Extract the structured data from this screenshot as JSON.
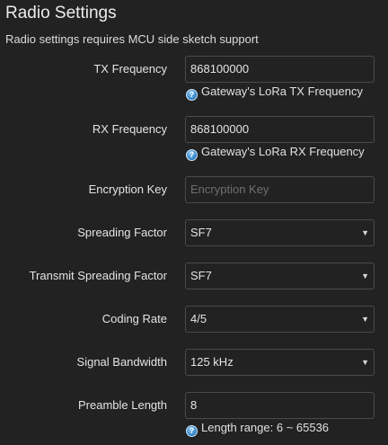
{
  "page": {
    "title": "Radio Settings",
    "description": "Radio settings requires MCU side sketch support"
  },
  "fields": {
    "tx_frequency": {
      "label": "TX Frequency",
      "value": "868100000",
      "hint": "Gateway's LoRa TX Frequency"
    },
    "rx_frequency": {
      "label": "RX Frequency",
      "value": "868100000",
      "hint": "Gateway's LoRa RX Frequency"
    },
    "encryption_key": {
      "label": "Encryption Key",
      "placeholder": "Encryption Key"
    },
    "spreading_factor": {
      "label": "Spreading Factor",
      "value": "SF7"
    },
    "transmit_spreading_factor": {
      "label": "Transmit Spreading Factor",
      "value": "SF7"
    },
    "coding_rate": {
      "label": "Coding Rate",
      "value": "4/5"
    },
    "signal_bandwidth": {
      "label": "Signal Bandwidth",
      "value": "125 kHz"
    },
    "preamble_length": {
      "label": "Preamble Length",
      "value": "8",
      "hint": "Length range: 6 ~ 65536"
    }
  },
  "icons": {
    "help": "help-icon",
    "dropdown": "chevron-down-icon"
  },
  "colors": {
    "background": "#222222",
    "help_icon": "#3d8fd0"
  }
}
